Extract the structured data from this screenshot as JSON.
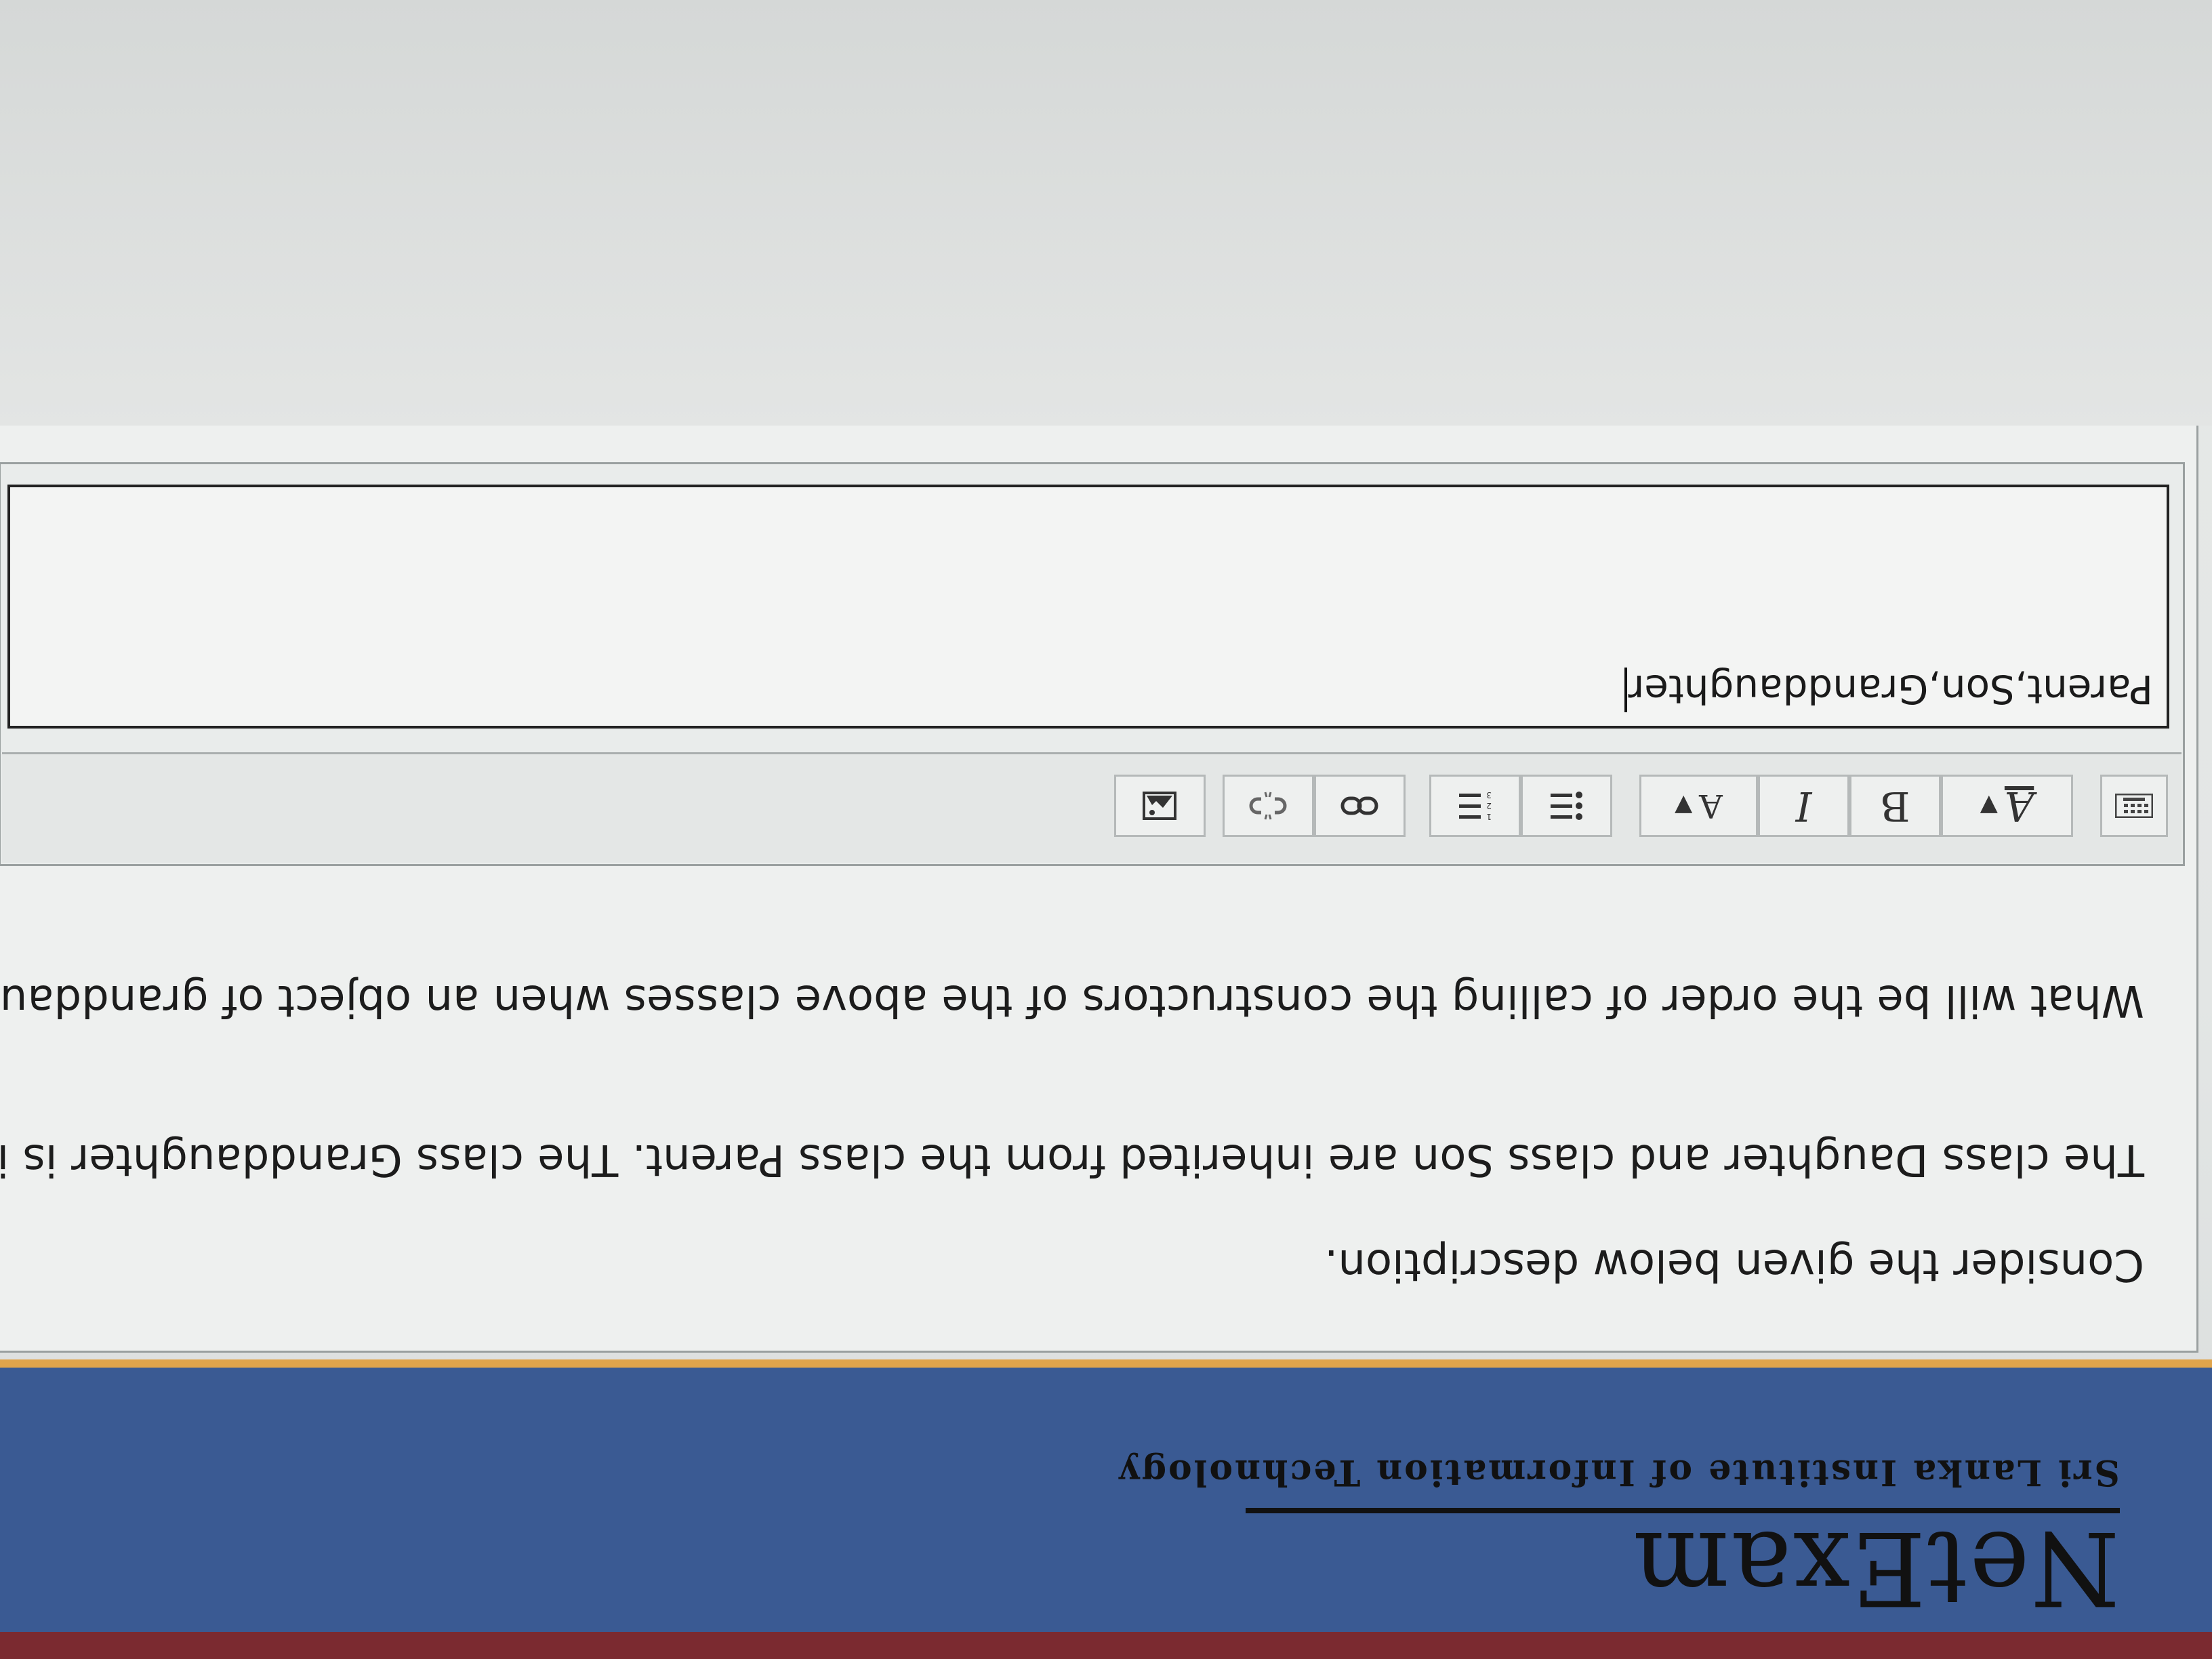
{
  "header": {
    "logo": "NetExam",
    "institute": "Sri Lanka Institute of Information Technology",
    "bar_color": "#3a5a93",
    "accent_color": "#e0a44b"
  },
  "question": {
    "intro": "Consider the given below description.",
    "description": "The class Daughter and class Son are inherited from the class Parent. The class Granddaughter is inherited from clas",
    "ask": "What will be the order of calling the constructors of the above classes when an object of granddaughter is created?"
  },
  "toolbar": {
    "show_more_icon": "keyboard-icon",
    "paragraph_style": "A",
    "bold": "B",
    "italic": "I",
    "font_color": "A",
    "bullet_list_icon": "bullet-list-icon",
    "numbered_list_icon": "numbered-list-icon",
    "link_icon": "link-icon",
    "unlink_icon": "unlink-icon",
    "image_icon": "image-icon"
  },
  "answer": {
    "value": "Parent,Son,Granddaughter"
  }
}
